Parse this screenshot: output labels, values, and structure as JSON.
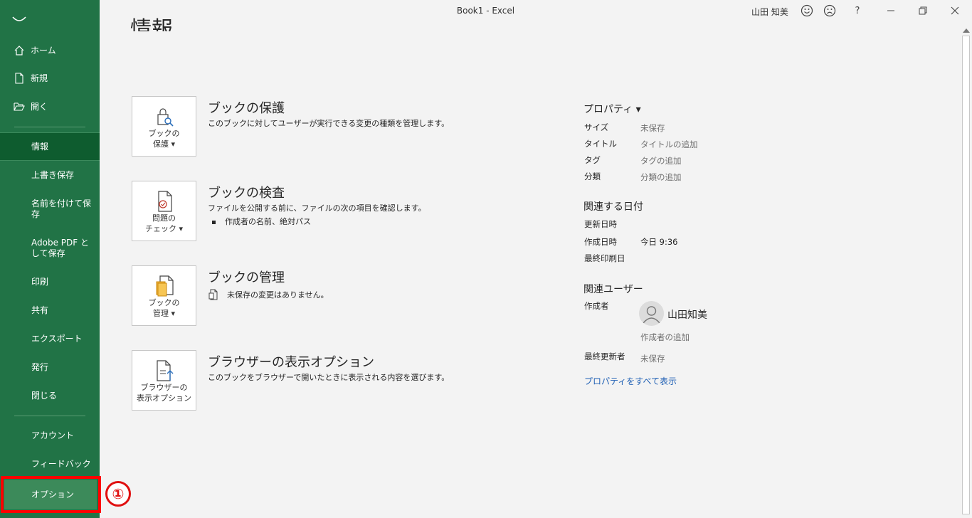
{
  "window": {
    "title": "Book1  -  Excel",
    "user": "山田 知美",
    "help": "?"
  },
  "sidebar": {
    "items": [
      {
        "label": "ホーム"
      },
      {
        "label": "新規"
      },
      {
        "label": "開く"
      },
      {
        "label": "情報"
      },
      {
        "label": "上書き保存"
      },
      {
        "label": "名前を付けて保存"
      },
      {
        "label": "Adobe PDF として保存"
      },
      {
        "label": "印刷"
      },
      {
        "label": "共有"
      },
      {
        "label": "エクスポート"
      },
      {
        "label": "発行"
      },
      {
        "label": "閉じる"
      },
      {
        "label": "アカウント"
      },
      {
        "label": "フィードバック"
      },
      {
        "label": "オプション"
      }
    ],
    "annotation": "①"
  },
  "page": {
    "heading": "情報"
  },
  "sections": [
    {
      "button": [
        "ブックの",
        "保護 ▾"
      ],
      "title": "ブックの保護",
      "desc": "このブックに対してユーザーが実行できる変更の種類を管理します。"
    },
    {
      "button": [
        "問題の",
        "チェック ▾"
      ],
      "title": "ブックの検査",
      "desc": "ファイルを公開する前に、ファイルの次の項目を確認します。",
      "bullet": "作成者の名前、絶対パス"
    },
    {
      "button": [
        "ブックの",
        "管理 ▾"
      ],
      "title": "ブックの管理",
      "desc": "未保存の変更はありません。"
    },
    {
      "button": [
        "ブラウザーの",
        "表示オプション"
      ],
      "title": "ブラウザーの表示オプション",
      "desc": "このブックをブラウザーで開いたときに表示される内容を選びます。"
    }
  ],
  "properties": {
    "heading": "プロパティ ▾",
    "rows": [
      {
        "label": "サイズ",
        "value": "未保存"
      },
      {
        "label": "タイトル",
        "value": "タイトルの追加"
      },
      {
        "label": "タグ",
        "value": "タグの追加"
      },
      {
        "label": "分類",
        "value": "分類の追加"
      }
    ],
    "dates_heading": "関連する日付",
    "dates": [
      {
        "label": "更新日時",
        "value": ""
      },
      {
        "label": "作成日時",
        "value": "今日 9:36"
      },
      {
        "label": "最終印刷日",
        "value": ""
      }
    ],
    "people_heading": "関連ユーザー",
    "author_label": "作成者",
    "author_name": "山田知美",
    "add_author": "作成者の追加",
    "last_modified_label": "最終更新者",
    "last_modified_value": "未保存",
    "show_all": "プロパティをすべて表示"
  }
}
